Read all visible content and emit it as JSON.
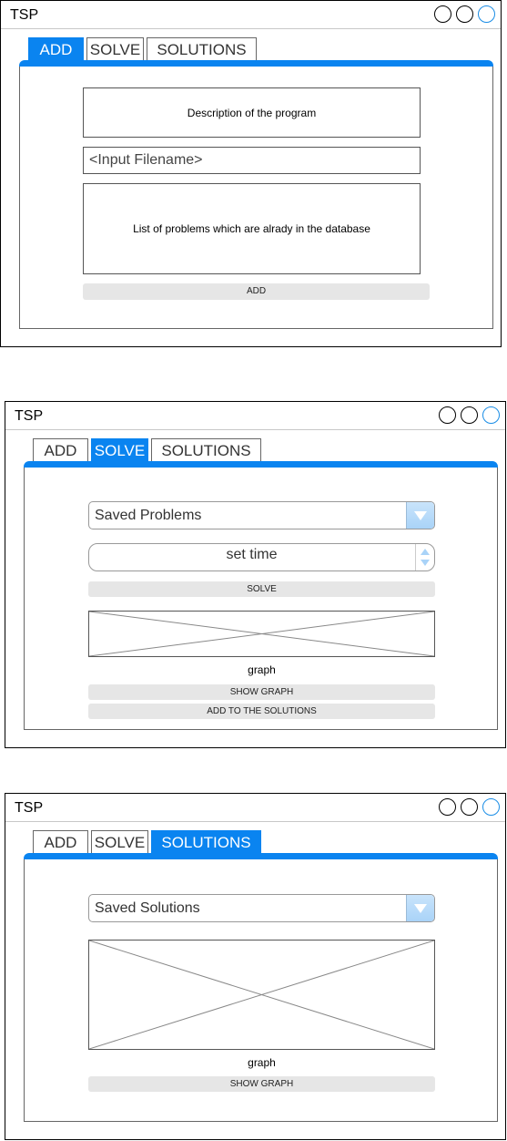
{
  "windows": [
    {
      "title": "TSP",
      "tabs": [
        "ADD",
        "SOLVE",
        "SOLUTIONS"
      ],
      "active_tab": "ADD",
      "description": "Description of the program",
      "filename_placeholder": "<Input Filename>",
      "problem_list": "List of problems which are alrady in the database",
      "add_button": "ADD"
    },
    {
      "title": "TSP",
      "tabs": [
        "ADD",
        "SOLVE",
        "SOLUTIONS"
      ],
      "active_tab": "SOLVE",
      "select_label": "Saved Problems",
      "spinner_label": "set time",
      "solve_button": "SOLVE",
      "graph_caption": "graph",
      "show_graph_button": "SHOW GRAPH",
      "add_solutions_button": "ADD TO THE SOLUTIONS"
    },
    {
      "title": "TSP",
      "tabs": [
        "ADD",
        "SOLVE",
        "SOLUTIONS"
      ],
      "active_tab": "SOLUTIONS",
      "select_label": "Saved Solutions",
      "graph_caption": "graph",
      "show_graph_button": "SHOW GRAPH"
    }
  ],
  "colors": {
    "accent": "#0a84f0",
    "button": "#e6e6e6",
    "border": "#555555"
  }
}
